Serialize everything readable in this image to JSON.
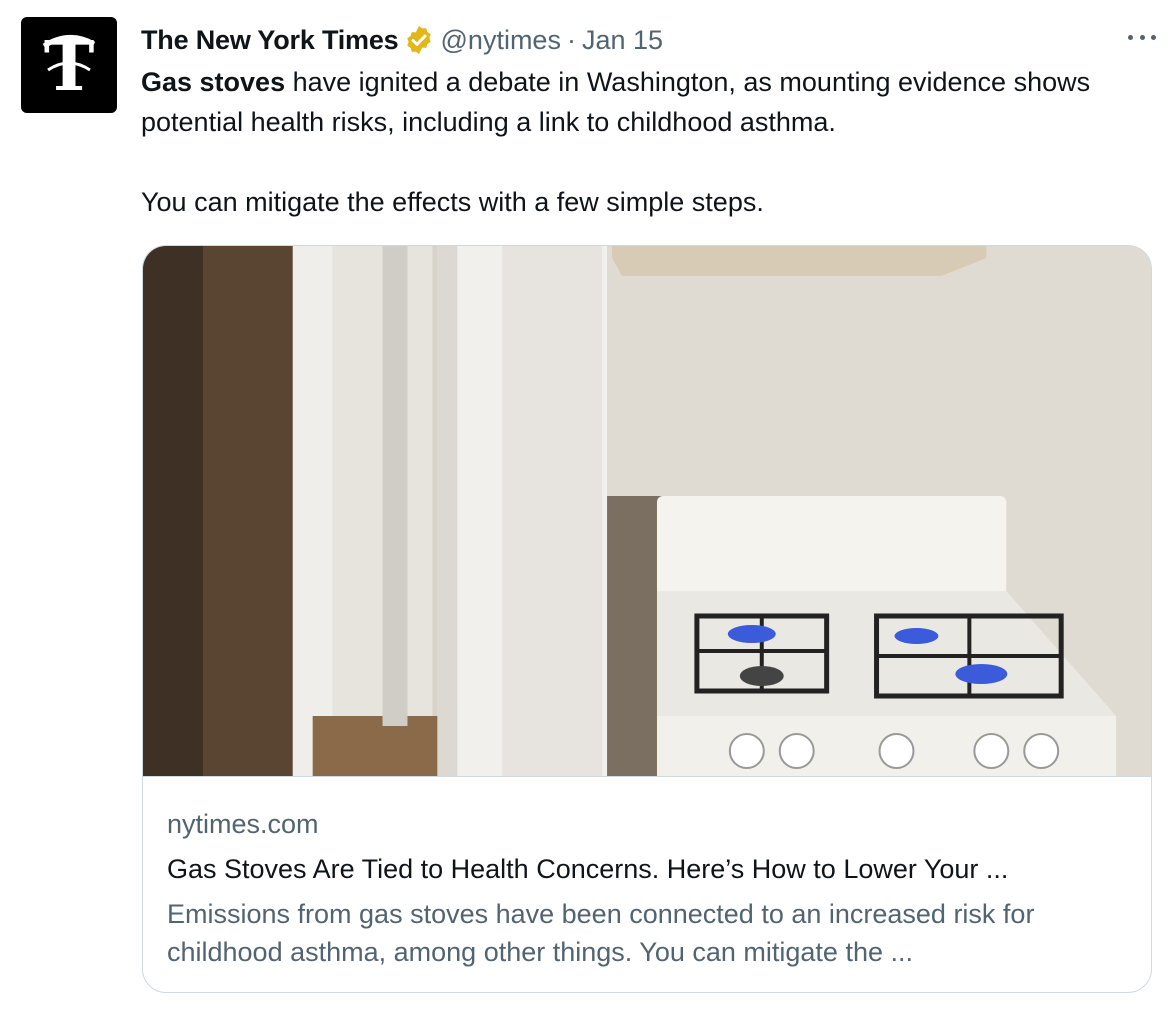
{
  "author": {
    "display_name": "The New York Times",
    "handle": "@nytimes",
    "separator": "·",
    "date": "Jan 15",
    "avatar_icon": "nyt-t-logo-icon",
    "verified_icon": "gold-verified-badge-icon",
    "verified_color": "#e2b719"
  },
  "tweet": {
    "text_bold": "Gas stoves",
    "text_rest": " have ignited a debate in Washington, as mounting evidence shows potential health risks, including a link to childhood asthma.",
    "text_second": "You can mitigate the effects with a few simple steps."
  },
  "card": {
    "image_desc_icon": "gas-stove-photo",
    "domain": "nytimes.com",
    "title": "Gas Stoves Are Tied to Health Concerns. Here’s How to Lower Your ...",
    "description": "Emissions from gas stoves have been connected to an increased risk for childhood asthma, among other things. You can mitigate the ..."
  },
  "colors": {
    "primary_text": "#0f1419",
    "secondary_text": "#536471",
    "border": "#cfd9de"
  },
  "more_icon": "more-options-icon"
}
